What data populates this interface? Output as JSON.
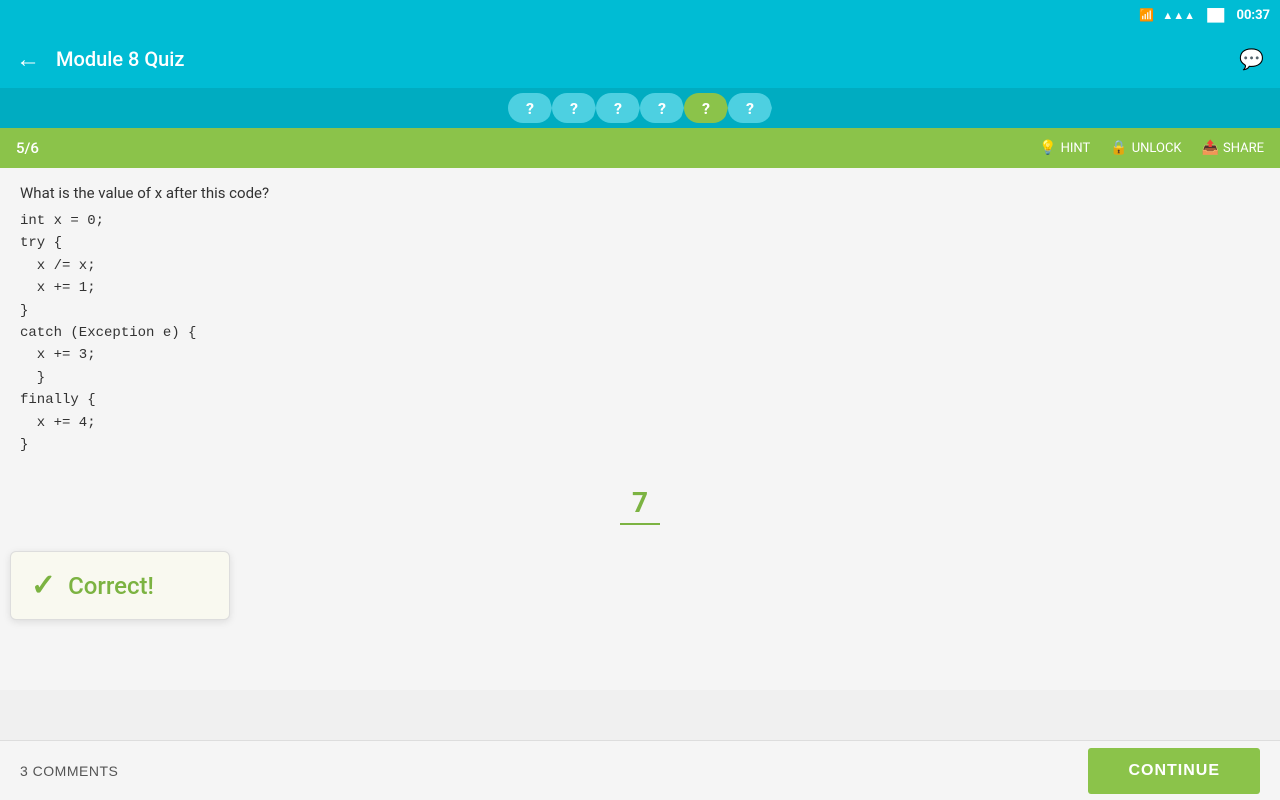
{
  "statusBar": {
    "wifi": "wifi",
    "signal": "signal",
    "battery": "battery",
    "time": "00:37"
  },
  "topBar": {
    "backIcon": "←",
    "title": "Module 8 Quiz",
    "chatIcon": "💬"
  },
  "progressBar": {
    "dots": [
      "?",
      "?",
      "?",
      "?",
      "?",
      "?"
    ],
    "activeIndex": 4
  },
  "subHeader": {
    "questionCount": "5/6",
    "hint": "HINT",
    "unlock": "UNLOCK",
    "share": "SHARE"
  },
  "question": {
    "text": "What is the value of x after this code?",
    "codeLines": [
      "int x = 0;",
      "try {",
      "  x /= x;",
      "  x += 1;",
      "}",
      "catch (Exception e) {",
      "  x += 3;",
      "}",
      "finally {",
      "  x += 4;",
      "}"
    ]
  },
  "answer": {
    "value": "7"
  },
  "correctBanner": {
    "checkmark": "✓",
    "text": "Correct!"
  },
  "bottomBar": {
    "comments": "3 COMMENTS",
    "continue": "CONTINUE"
  }
}
